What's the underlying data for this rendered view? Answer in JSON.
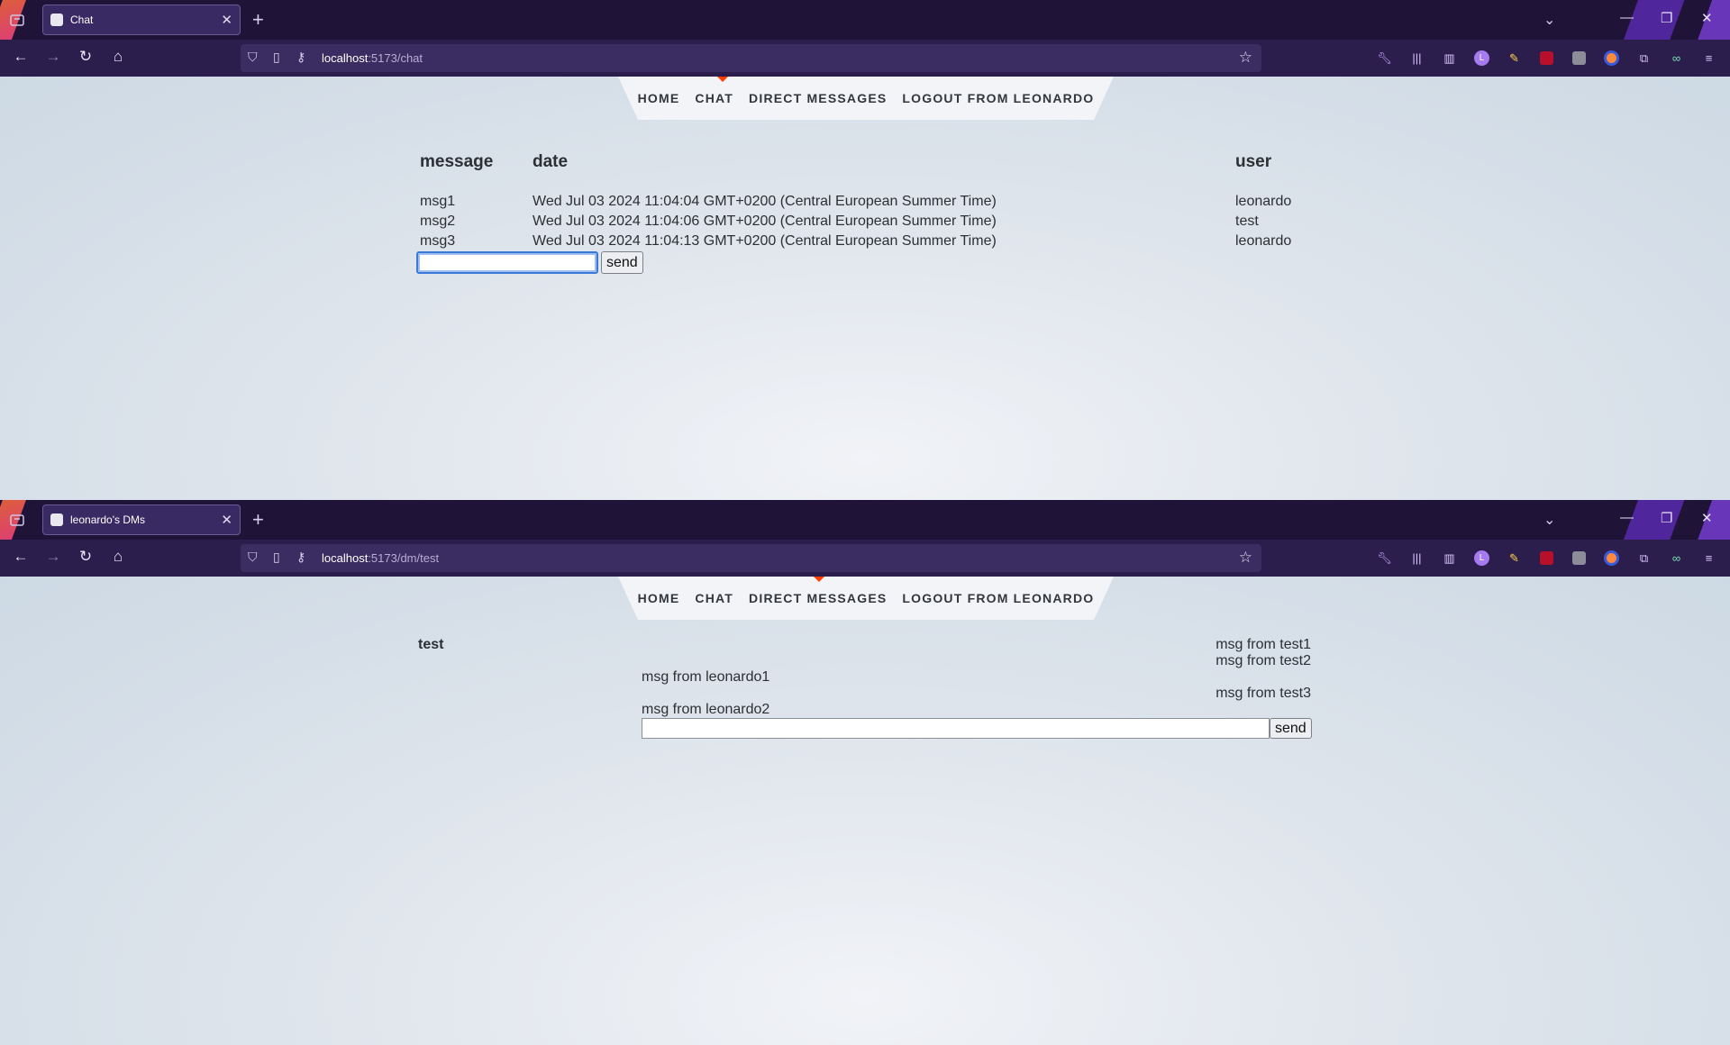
{
  "windows": [
    {
      "tab_title": "Chat",
      "url_host": "localhost",
      "url_path": ":5173/chat",
      "nav": [
        "HOME",
        "CHAT",
        "DIRECT MESSAGES",
        "LOGOUT FROM LEONARDO"
      ],
      "chat": {
        "headers": {
          "message": "message",
          "date": "date",
          "user": "user"
        },
        "rows": [
          {
            "message": "msg1",
            "date": "Wed Jul 03 2024 11:04:04 GMT+0200 (Central European Summer Time)",
            "user": "leonardo"
          },
          {
            "message": "msg2",
            "date": "Wed Jul 03 2024 11:04:06 GMT+0200 (Central European Summer Time)",
            "user": "test"
          },
          {
            "message": "msg3",
            "date": "Wed Jul 03 2024 11:04:13 GMT+0200 (Central European Summer Time)",
            "user": "leonardo"
          }
        ],
        "input_value": "",
        "send_label": "send"
      }
    },
    {
      "tab_title": "leonardo's DMs",
      "url_host": "localhost",
      "url_path": ":5173/dm/test",
      "nav": [
        "HOME",
        "CHAT",
        "DIRECT MESSAGES",
        "LOGOUT FROM LEONARDO"
      ],
      "dm": {
        "partner": "test",
        "messages": [
          {
            "from": "test",
            "text": "msg from test1"
          },
          {
            "from": "test",
            "text": "msg from test2"
          },
          {
            "from": "leonardo",
            "text": "msg from leonardo1"
          },
          {
            "from": "test",
            "text": "msg from test3"
          },
          {
            "from": "leonardo",
            "text": "msg from leonardo2"
          }
        ],
        "input_value": "",
        "send_label": "send"
      }
    }
  ],
  "browser": {
    "icons": [
      "tab-list-icon",
      "new-tab-icon",
      "list-all-tabs-icon",
      "minimize-icon",
      "maximize-icon",
      "close-window-icon",
      "back-icon",
      "forward-icon",
      "reload-icon",
      "home-icon",
      "shield-icon",
      "page-icon",
      "key-icon",
      "bookmark-star-icon",
      "wrench-icon",
      "library-icon",
      "sidebar-icon",
      "extension-l-icon",
      "extension-pen-icon",
      "ublock-icon",
      "extension-s-icon",
      "extension-circle-icon",
      "extensions-puzzle-icon",
      "extension-glasses-icon",
      "menu-icon"
    ],
    "accent": "#ff3e00",
    "toolbar_bg": "#2b1e4d",
    "tabstrip_bg": "#1f1437"
  }
}
